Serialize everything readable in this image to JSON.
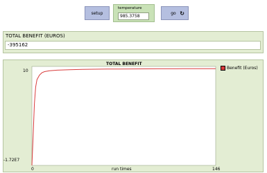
{
  "buttons": {
    "setup_label": "setup",
    "go_label": "go",
    "forever_icon": "forever-icon",
    "color": "#b5bfe0"
  },
  "slider": {
    "label": "temperature",
    "value": "985.3758",
    "color": "#c9e2b7"
  },
  "monitor": {
    "label": "TOTAL BENEFIT (EUROS)",
    "value": "-395162"
  },
  "plot": {
    "title": "TOTAL BENEFIT",
    "xlabel": "run times",
    "y_max_label": "10",
    "y_min_label": "-1.72E7",
    "x_min_label": "0",
    "x_max_label": "146",
    "legend": [
      {
        "name": "Benefit (Euros)",
        "color": "#d83b3b"
      }
    ]
  },
  "chart_data": {
    "type": "line",
    "title": "TOTAL BENEFIT",
    "xlabel": "run times",
    "ylabel": "",
    "xlim": [
      0,
      146
    ],
    "ylim": [
      -17200000,
      10
    ],
    "legend_placement": "right",
    "series": [
      {
        "name": "Benefit (Euros)",
        "color": "#d83b3b",
        "points": [
          [
            0,
            -17200000
          ],
          [
            1,
            -12000000
          ],
          [
            2,
            -6500000
          ],
          [
            3,
            -3600000
          ],
          [
            4,
            -2300000
          ],
          [
            6,
            -1500000
          ],
          [
            8,
            -1100000
          ],
          [
            10,
            -900000
          ],
          [
            14,
            -750000
          ],
          [
            20,
            -650000
          ],
          [
            30,
            -560000
          ],
          [
            40,
            -510000
          ],
          [
            50,
            -480000
          ],
          [
            60,
            -460000
          ],
          [
            70,
            -440000
          ],
          [
            80,
            -430000
          ],
          [
            90,
            -420000
          ],
          [
            100,
            -410000
          ],
          [
            110,
            -405000
          ],
          [
            120,
            -400000
          ],
          [
            130,
            -398000
          ],
          [
            140,
            -396000
          ],
          [
            146,
            -395162
          ]
        ]
      }
    ]
  }
}
